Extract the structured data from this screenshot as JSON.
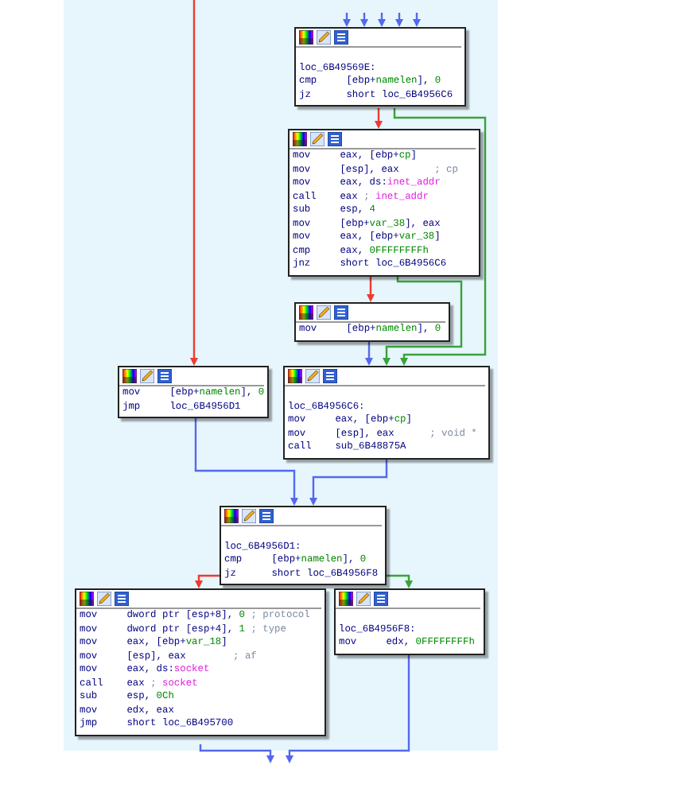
{
  "nodes": [
    {
      "label": "loc_6B49569E:",
      "lines": [
        [
          {
            "text": "cmp     [ebp+",
            "kind": "code"
          },
          {
            "text": "namelen",
            "kind": "var"
          },
          {
            "text": "], ",
            "kind": "code"
          },
          {
            "text": "0",
            "kind": "num"
          }
        ],
        [
          {
            "text": "jz      short loc_6B4956C6",
            "kind": "code"
          }
        ]
      ]
    },
    {
      "lines": [
        [
          {
            "text": "mov     eax, [ebp+",
            "kind": "code"
          },
          {
            "text": "cp",
            "kind": "var"
          },
          {
            "text": "]",
            "kind": "code"
          }
        ],
        [
          {
            "text": "mov     [esp], eax      ",
            "kind": "code"
          },
          {
            "text": "; cp",
            "kind": "comment"
          }
        ],
        [
          {
            "text": "mov     eax, ds:",
            "kind": "code"
          },
          {
            "text": "inet_addr",
            "kind": "import"
          }
        ],
        [
          {
            "text": "call    eax ",
            "kind": "code"
          },
          {
            "text": "; ",
            "kind": "comment"
          },
          {
            "text": "inet_addr",
            "kind": "import"
          }
        ],
        [
          {
            "text": "sub     esp, ",
            "kind": "code"
          },
          {
            "text": "4",
            "kind": "num"
          }
        ],
        [
          {
            "text": "mov     [ebp+",
            "kind": "code"
          },
          {
            "text": "var_38",
            "kind": "var"
          },
          {
            "text": "], eax",
            "kind": "code"
          }
        ],
        [
          {
            "text": "mov     eax, [ebp+",
            "kind": "code"
          },
          {
            "text": "var_38",
            "kind": "var"
          },
          {
            "text": "]",
            "kind": "code"
          }
        ],
        [
          {
            "text": "cmp     eax, ",
            "kind": "code"
          },
          {
            "text": "0FFFFFFFFh",
            "kind": "num"
          }
        ],
        [
          {
            "text": "jnz     short loc_6B4956C6",
            "kind": "code"
          }
        ]
      ]
    },
    {
      "lines": [
        [
          {
            "text": "mov     [ebp+",
            "kind": "code"
          },
          {
            "text": "namelen",
            "kind": "var"
          },
          {
            "text": "], ",
            "kind": "code"
          },
          {
            "text": "0",
            "kind": "num"
          }
        ]
      ]
    },
    {
      "lines": [
        [
          {
            "text": "mov     [ebp+",
            "kind": "code"
          },
          {
            "text": "namelen",
            "kind": "var"
          },
          {
            "text": "], ",
            "kind": "code"
          },
          {
            "text": "0",
            "kind": "num"
          }
        ],
        [
          {
            "text": "jmp     loc_6B4956D1",
            "kind": "code"
          }
        ]
      ]
    },
    {
      "label": "loc_6B4956C6:",
      "lines": [
        [
          {
            "text": "mov     eax, [ebp+",
            "kind": "code"
          },
          {
            "text": "cp",
            "kind": "var"
          },
          {
            "text": "]",
            "kind": "code"
          }
        ],
        [
          {
            "text": "mov     [esp], eax      ",
            "kind": "code"
          },
          {
            "text": "; void *",
            "kind": "comment"
          }
        ],
        [
          {
            "text": "call    sub_6B48875A",
            "kind": "code"
          }
        ]
      ]
    },
    {
      "label": "loc_6B4956D1:",
      "lines": [
        [
          {
            "text": "cmp     [ebp+",
            "kind": "code"
          },
          {
            "text": "namelen",
            "kind": "var"
          },
          {
            "text": "], ",
            "kind": "code"
          },
          {
            "text": "0",
            "kind": "num"
          }
        ],
        [
          {
            "text": "jz      short loc_6B4956F8",
            "kind": "code"
          }
        ]
      ]
    },
    {
      "lines": [
        [
          {
            "text": "mov     dword ptr [esp+8], ",
            "kind": "code"
          },
          {
            "text": "0",
            "kind": "num"
          },
          {
            "text": " ; protocol",
            "kind": "comment"
          }
        ],
        [
          {
            "text": "mov     dword ptr [esp+4], ",
            "kind": "code"
          },
          {
            "text": "1",
            "kind": "num"
          },
          {
            "text": " ; type",
            "kind": "comment"
          }
        ],
        [
          {
            "text": "mov     eax, [ebp+",
            "kind": "code"
          },
          {
            "text": "var_18",
            "kind": "var"
          },
          {
            "text": "]",
            "kind": "code"
          }
        ],
        [
          {
            "text": "mov     [esp], eax        ",
            "kind": "code"
          },
          {
            "text": "; af",
            "kind": "comment"
          }
        ],
        [
          {
            "text": "mov     eax, ds:",
            "kind": "code"
          },
          {
            "text": "socket",
            "kind": "import"
          }
        ],
        [
          {
            "text": "call    eax ",
            "kind": "code"
          },
          {
            "text": "; ",
            "kind": "comment"
          },
          {
            "text": "socket",
            "kind": "import"
          }
        ],
        [
          {
            "text": "sub     esp, ",
            "kind": "code"
          },
          {
            "text": "0Ch",
            "kind": "num"
          }
        ],
        [
          {
            "text": "mov     edx, eax",
            "kind": "code"
          }
        ],
        [
          {
            "text": "jmp     short loc_6B495700",
            "kind": "code"
          }
        ]
      ]
    },
    {
      "label": "loc_6B4956F8:",
      "lines": [
        [
          {
            "text": "mov     edx, ",
            "kind": "code"
          },
          {
            "text": "0FFFFFFFFh",
            "kind": "num"
          }
        ]
      ]
    }
  ],
  "edges": [
    {
      "kind": "jump"
    },
    {
      "kind": "jump"
    },
    {
      "kind": "jump"
    },
    {
      "kind": "jump"
    },
    {
      "kind": "jump"
    },
    {
      "kind": "false"
    },
    {
      "kind": "false"
    },
    {
      "kind": "true"
    },
    {
      "kind": "false"
    },
    {
      "kind": "true"
    },
    {
      "kind": "jump"
    },
    {
      "kind": "jump"
    },
    {
      "kind": "jump"
    },
    {
      "kind": "false"
    },
    {
      "kind": "true"
    },
    {
      "kind": "jump"
    },
    {
      "kind": "jump"
    }
  ]
}
